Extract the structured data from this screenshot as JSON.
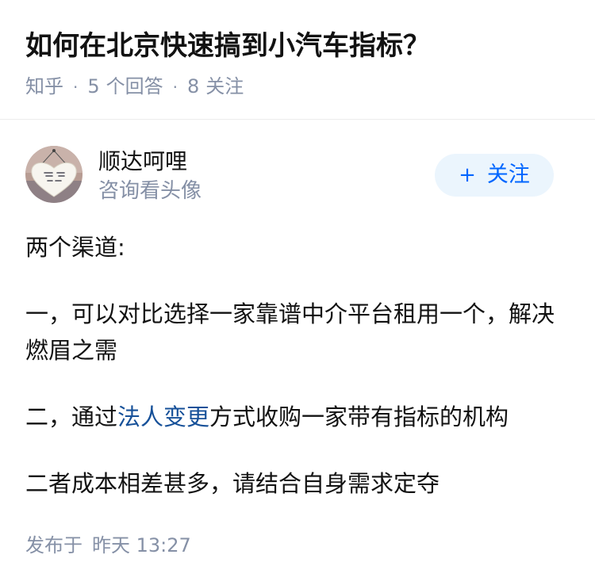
{
  "question": {
    "title": "如何在北京快速搞到小汽车指标？",
    "source": "知乎",
    "separator": "·",
    "answer_count": "5",
    "answer_label": "个回答",
    "follower_count": "8",
    "follower_label": "关注"
  },
  "answer": {
    "author": {
      "name": "顺达呵哩",
      "headline": "咨询看头像",
      "avatar_icon": "avatar-heart-sign-icon"
    },
    "follow_button": {
      "icon": "plus-icon",
      "plus": "+",
      "label": "关注"
    },
    "paragraphs": [
      "两个渠道:",
      "一，可以对比选择一家靠谱中介平台租用一个，解决燃眉之需",
      {
        "before": "二，通过",
        "link": "法人变更",
        "after": "方式收购一家带有指标的机构"
      },
      "二者成本相差甚多，请结合自身需求定夺"
    ],
    "published_label": "发布于",
    "published_time": "昨天 13:27"
  },
  "colors": {
    "text": "#121212",
    "meta": "#8590a6",
    "link": "#175199",
    "accent": "#0066ff",
    "follow_bg": "#ebf5fd",
    "divider": "#ececec"
  }
}
